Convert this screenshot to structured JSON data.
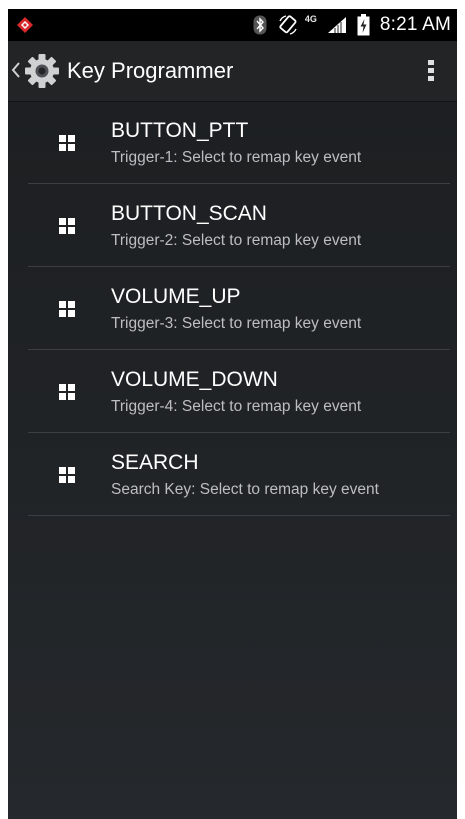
{
  "status_bar": {
    "network_type": "4G",
    "time": "8:21 AM",
    "icons": [
      "app-notification-icon",
      "bluetooth-icon",
      "rotation-icon",
      "signal-icon",
      "battery-charging-icon"
    ]
  },
  "action_bar": {
    "title": "Key Programmer",
    "up_icon": "chevron-left-icon",
    "app_icon": "gear-icon",
    "overflow_icon": "overflow-menu-icon"
  },
  "key_list": {
    "item_icon": "grid-icon",
    "items": [
      {
        "title": "BUTTON_PTT",
        "subtitle": "Trigger-1: Select to remap key event"
      },
      {
        "title": "BUTTON_SCAN",
        "subtitle": "Trigger-2: Select to remap key event"
      },
      {
        "title": "VOLUME_UP",
        "subtitle": "Trigger-3: Select to remap key event"
      },
      {
        "title": "VOLUME_DOWN",
        "subtitle": "Trigger-4: Select to remap key event"
      },
      {
        "title": "SEARCH",
        "subtitle": "Search Key: Select to remap key event"
      }
    ]
  },
  "colors": {
    "status_bar": "#000000",
    "action_bar": "#222426",
    "background": "#202326",
    "divider": "#3b3e42",
    "primary_text": "#ffffff",
    "secondary_text": "#bcbec0",
    "notification_accent": "#d8282c"
  }
}
